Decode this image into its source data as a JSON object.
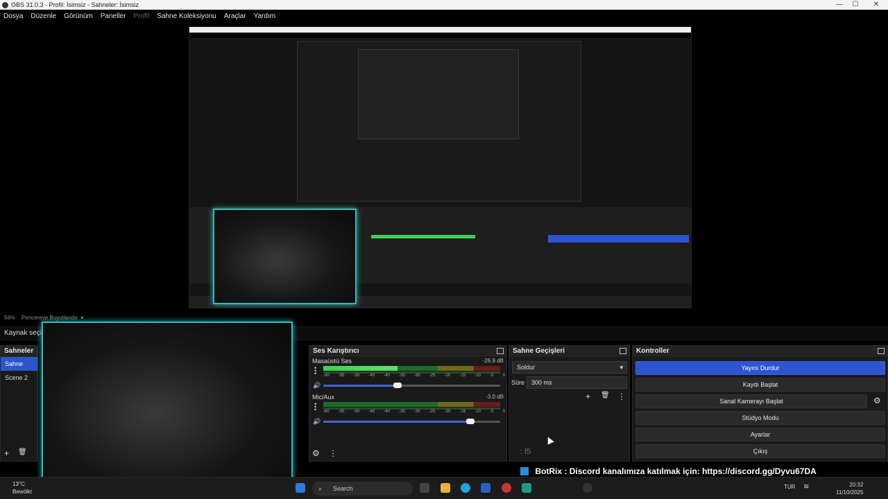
{
  "window": {
    "title": "OBS 31.0.3 - Profil: İsimsiz - Sahneler: İsimsiz",
    "controls": [
      "—",
      "☐",
      "✕"
    ]
  },
  "menu": {
    "items": [
      {
        "label": "Dosya",
        "enabled": true
      },
      {
        "label": "Düzenle",
        "enabled": true
      },
      {
        "label": "Görünüm",
        "enabled": true
      },
      {
        "label": "Paneller",
        "enabled": true
      },
      {
        "label": "Profil",
        "enabled": false
      },
      {
        "label": "Sahne Koleksiyonu",
        "enabled": true
      },
      {
        "label": "Araçlar",
        "enabled": true
      },
      {
        "label": "Yardım",
        "enabled": true
      }
    ]
  },
  "status": {
    "zoom": "56%",
    "fit": "Pencereye Boyutlandır"
  },
  "sources_bar": {
    "label": "Kaynak seçili"
  },
  "scenes": {
    "title": "Sahneler",
    "items": [
      {
        "label": "Sahne",
        "selected": true
      },
      {
        "label": "Scene 2",
        "selected": false
      }
    ]
  },
  "mixer": {
    "title": "Ses Karıştırıcı",
    "ticks": [
      "-60",
      "-55",
      "-50",
      "-45",
      "-40",
      "-35",
      "-30",
      "-25",
      "-20",
      "-15",
      "-10",
      "-5",
      "0"
    ],
    "channels": [
      {
        "name": "Masaüstü Ses",
        "db": "-26.9 dB",
        "level": 0.42,
        "volume": 0.42
      },
      {
        "name": "Mic/Aux",
        "db": "-3.0 dB",
        "level": 0.0,
        "volume": 0.83
      }
    ]
  },
  "transitions": {
    "title": "Sahne Geçişleri",
    "selected": "Soldur",
    "duration_label": "Süre",
    "duration_value": "300 ms"
  },
  "controls": {
    "title": "Kontroller",
    "buttons": [
      {
        "label": "Yayını Durdur",
        "primary": true
      },
      {
        "label": "Kaydı Başlat",
        "primary": false
      },
      {
        "label": "Sanal Kamerayı Başlat",
        "primary": false
      },
      {
        "label": "Stüdyo Modu",
        "primary": false
      },
      {
        "label": "Ayarlar",
        "primary": false
      },
      {
        "label": "Çıkış",
        "primary": false
      }
    ]
  },
  "overlay": {
    "ticker_user": "BotRix",
    "ticker_text": ": Discord kanalımıza katılmak için: https://discord.gg/Dyvu67DA",
    "chat_tail": ": f5"
  },
  "taskbar": {
    "temperature": "13°C",
    "weather": "Bewölkt",
    "search": "Search",
    "lang": "TUR",
    "time": "20:32",
    "date": "11/10/2025"
  },
  "colors": {
    "accent": "#2f54d2",
    "cam_border": "#39b7b4"
  }
}
